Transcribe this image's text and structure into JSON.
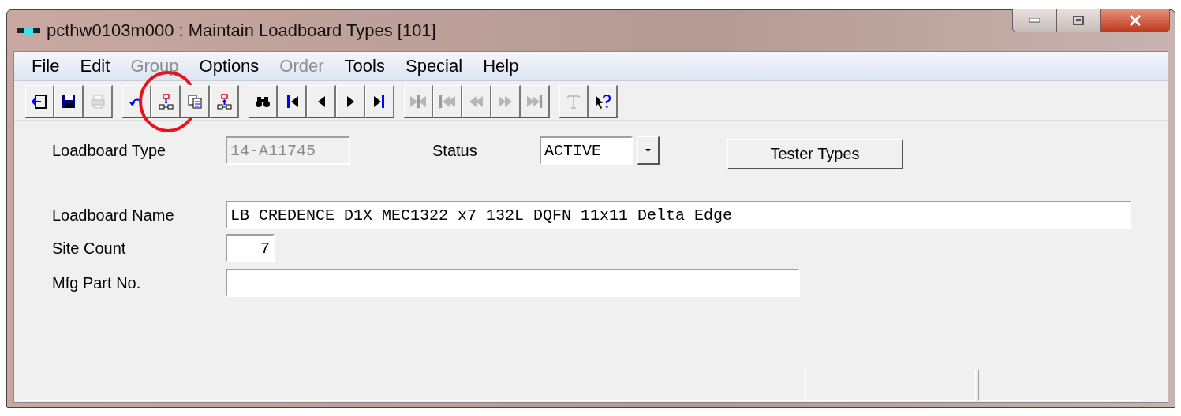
{
  "window": {
    "title": "pcthw0103m000 : Maintain Loadboard Types [101]"
  },
  "menu": [
    {
      "label": "File",
      "disabled": false
    },
    {
      "label": "Edit",
      "disabled": false
    },
    {
      "label": "Group",
      "disabled": true
    },
    {
      "label": "Options",
      "disabled": false
    },
    {
      "label": "Order",
      "disabled": true
    },
    {
      "label": "Tools",
      "disabled": false
    },
    {
      "label": "Special",
      "disabled": false
    },
    {
      "label": "Help",
      "disabled": false
    }
  ],
  "toolbar": [
    [
      {
        "kind": "exit",
        "disabled": false
      },
      {
        "kind": "save",
        "disabled": false
      },
      {
        "kind": "print",
        "disabled": true
      }
    ],
    [
      {
        "kind": "undo",
        "disabled": false
      },
      {
        "kind": "insert-below",
        "disabled": false,
        "highlighted": true
      },
      {
        "kind": "copy",
        "disabled": false
      },
      {
        "kind": "insert-above",
        "disabled": false
      }
    ],
    [
      {
        "kind": "find",
        "disabled": false
      },
      {
        "kind": "first",
        "disabled": false
      },
      {
        "kind": "prev",
        "disabled": false
      },
      {
        "kind": "next",
        "disabled": false
      },
      {
        "kind": "last",
        "disabled": false
      }
    ],
    [
      {
        "kind": "set-mid",
        "disabled": true
      },
      {
        "kind": "set-first",
        "disabled": true
      },
      {
        "kind": "set-prev",
        "disabled": true
      },
      {
        "kind": "set-next",
        "disabled": true
      },
      {
        "kind": "set-last",
        "disabled": true
      }
    ],
    [
      {
        "kind": "text",
        "disabled": true
      },
      {
        "kind": "help",
        "disabled": false
      }
    ]
  ],
  "form": {
    "loadboard_type": {
      "label": "Loadboard Type",
      "value": "14-A11745",
      "disabled": true
    },
    "status": {
      "label": "Status",
      "value": "ACTIVE"
    },
    "tester_types_button": "Tester Types",
    "loadboard_name": {
      "label": "Loadboard Name",
      "value": "LB CREDENCE D1X MEC1322 x7 132L DQFN 11x11 Delta Edge"
    },
    "site_count": {
      "label": "Site Count",
      "value": "7"
    },
    "mfg_part_no": {
      "label": "Mfg Part No."
    }
  }
}
